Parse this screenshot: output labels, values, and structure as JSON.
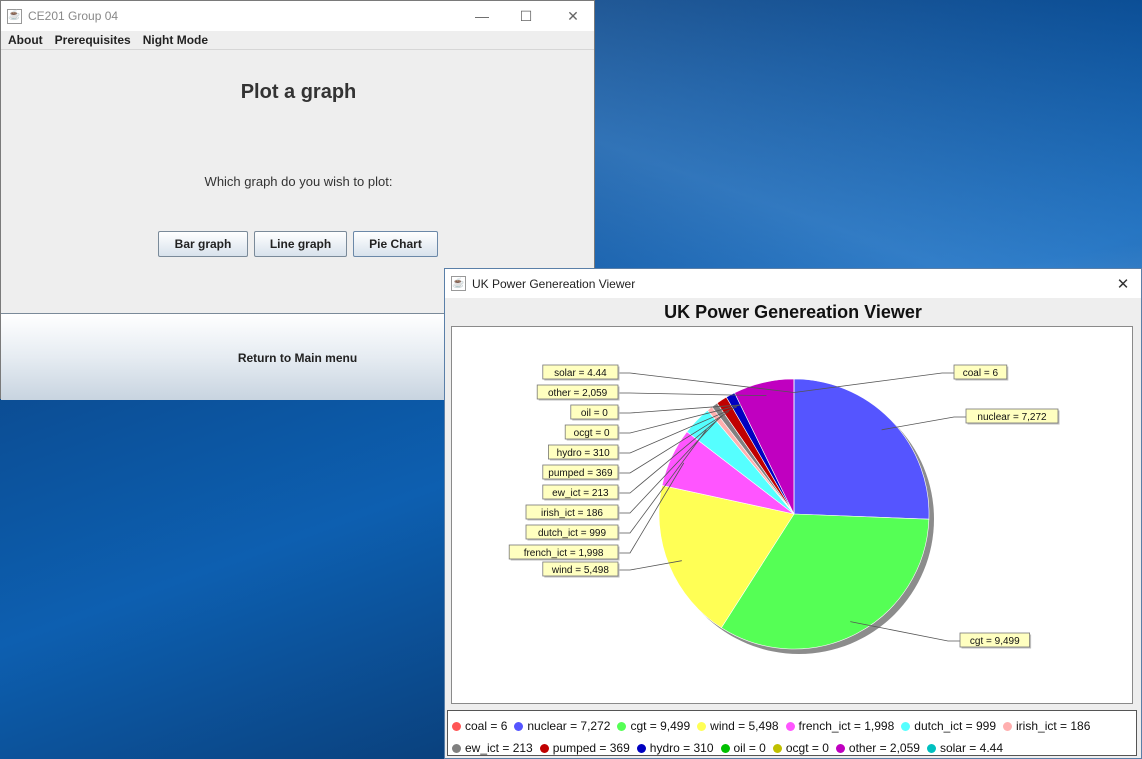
{
  "window1": {
    "title": "CE201 Group 04",
    "menu": [
      "About",
      "Prerequisites",
      "Night Mode"
    ],
    "heading": "Plot a graph",
    "question": "Which graph do you wish to plot:",
    "buttons": {
      "bar": "Bar graph",
      "line": "Line graph",
      "pie": "Pie Chart"
    },
    "return_label": "Return to Main menu"
  },
  "window2": {
    "title": "UK Power Genereation Viewer"
  },
  "chart_data": {
    "type": "pie",
    "title": "UK Power Genereation Viewer",
    "legend_placement": "bottom",
    "slices": [
      {
        "name": "coal",
        "value": 6,
        "label": "coal = 6",
        "color": "#ff5555"
      },
      {
        "name": "nuclear",
        "value": 7272,
        "label": "nuclear = 7,272",
        "color": "#5555ff"
      },
      {
        "name": "cgt",
        "value": 9499,
        "label": "cgt = 9,499",
        "color": "#55ff55"
      },
      {
        "name": "wind",
        "value": 5498,
        "label": "wind = 5,498",
        "color": "#ffff55"
      },
      {
        "name": "french_ict",
        "value": 1998,
        "label": "french_ict = 1,998",
        "color": "#ff55ff"
      },
      {
        "name": "dutch_ict",
        "value": 999,
        "label": "dutch_ict = 999",
        "color": "#55ffff"
      },
      {
        "name": "irish_ict",
        "value": 186,
        "label": "irish_ict = 186",
        "color": "#ffafaf"
      },
      {
        "name": "ew_ict",
        "value": 213,
        "label": "ew_ict = 213",
        "color": "#808080"
      },
      {
        "name": "pumped",
        "value": 369,
        "label": "pumped = 369",
        "color": "#c00000"
      },
      {
        "name": "hydro",
        "value": 310,
        "label": "hydro = 310",
        "color": "#0000c0"
      },
      {
        "name": "oil",
        "value": 0,
        "label": "oil = 0",
        "color": "#00c000"
      },
      {
        "name": "ocgt",
        "value": 0,
        "label": "ocgt = 0",
        "color": "#c0c000"
      },
      {
        "name": "other",
        "value": 2059,
        "label": "other = 2,059",
        "color": "#c000c0"
      },
      {
        "name": "solar",
        "value": 4.44,
        "label": "solar = 4.44",
        "color": "#00c0c0"
      }
    ]
  }
}
